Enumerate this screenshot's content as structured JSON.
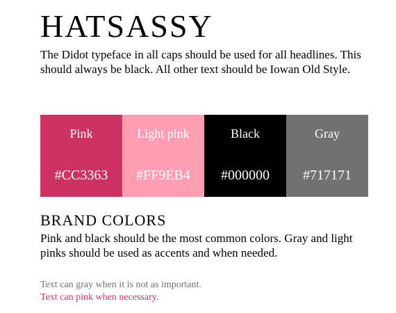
{
  "headline": "HATSASSY",
  "intro_text": "The Didot typeface in all caps should be used for all headlines. This should always be black. All other text should be Iowan Old Style.",
  "swatches": [
    {
      "name": "Pink",
      "hex": "#CC3363",
      "color": "#CC3363",
      "text_color": "#FFFFFF"
    },
    {
      "name": "Light pink",
      "hex": "#FF9EB4",
      "color": "#FF9EB4",
      "text_color": "#FFFFFF"
    },
    {
      "name": "Black",
      "hex": "#000000",
      "color": "#000000",
      "text_color": "#FFFFFF"
    },
    {
      "name": "Gray",
      "hex": "#717171",
      "color": "#717171",
      "text_color": "#FFFFFF"
    }
  ],
  "section_title": "BRAND COLORS",
  "brand_text": "Pink and black should be the most common colors. Gray and light pinks should be used as accents and when needed.",
  "notes": {
    "gray": {
      "text": "Text can gray when it is not as important.",
      "color": "#717171"
    },
    "pink": {
      "text": "Text can pink when necessary.",
      "color": "#CC3363"
    }
  }
}
